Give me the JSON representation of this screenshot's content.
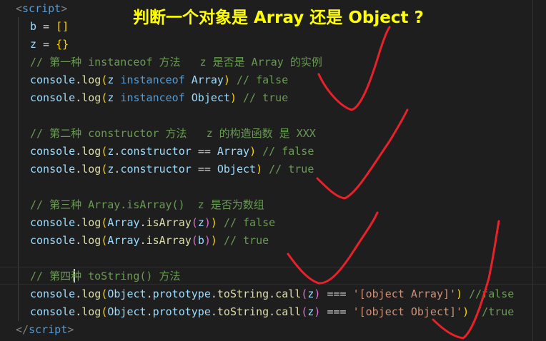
{
  "annotation": {
    "title": "判断一个对象是 Array 还是 Object ?"
  },
  "code": {
    "open_tag": "script",
    "close_tag": "script",
    "l1": {
      "var": "b",
      "val": "[]"
    },
    "l2": {
      "var": "z",
      "val": "{}"
    },
    "c1": "// 第一种 instanceof 方法   z 是否是 Array 的实例",
    "c2": "// 第二种 constructor 方法   z 的构造函数 是 XXX",
    "c3": "// 第三种 Array.isArray()  z 是否为数组",
    "c4": "// 第四种 toString() 方法",
    "r1": {
      "res": "// false",
      "expr": "instanceof",
      "cls": "Array"
    },
    "r2": {
      "res": "// true",
      "expr": "instanceof",
      "cls": "Object"
    },
    "r3": {
      "res": "// false",
      "cls": "Array"
    },
    "r4": {
      "res": "// true",
      "cls": "Object"
    },
    "r5": {
      "res": "// false",
      "arg": "z"
    },
    "r6": {
      "res": "// true",
      "arg": "b"
    },
    "r7": {
      "str": "'[object Array]'",
      "res": "//false"
    },
    "r8": {
      "str": "'[object Object]'",
      "res": "//true"
    },
    "console": "console",
    "log": "log",
    "constructor": "constructor",
    "array": "Array",
    "isArray": "isArray",
    "object": "Object",
    "prototype": "prototype",
    "toString": "toString",
    "call": "call",
    "eq2": "==",
    "eq3": "===",
    "z": "z"
  },
  "colors": {
    "annotation": "#ffff00",
    "marks": "#e8212b",
    "background": "#1e1e1e"
  }
}
